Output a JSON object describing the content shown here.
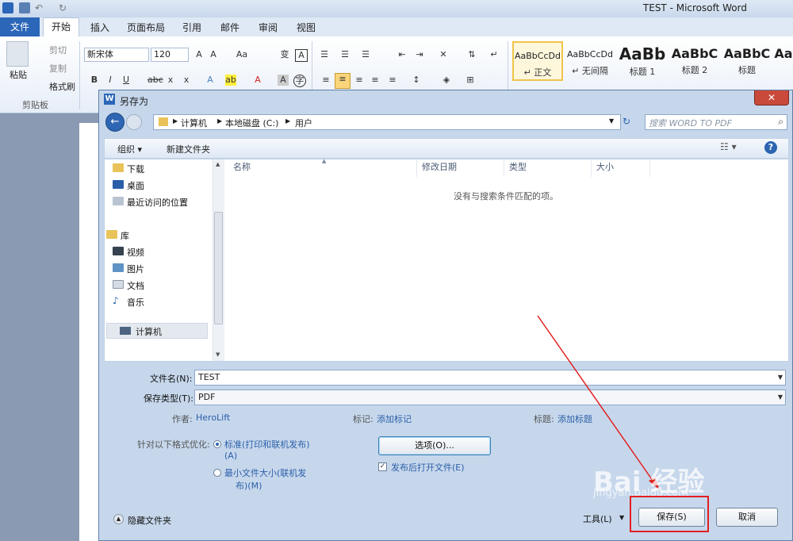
{
  "word": {
    "window_title": "TEST  -  Microsoft Word",
    "tabs": [
      "文件",
      "开始",
      "插入",
      "页面布局",
      "引用",
      "邮件",
      "审阅",
      "视图"
    ],
    "clipboard": {
      "paste": "粘贴",
      "cut": "剪切",
      "copy": "复制",
      "format_painter": "格式刷",
      "group": "剪贴板"
    },
    "font_name": "新宋体",
    "font_size": "120",
    "styles": [
      {
        "preview": "AaBbCcDd",
        "name": "↵ 正文"
      },
      {
        "preview": "AaBbCcDd",
        "name": "↵ 无间隔"
      },
      {
        "preview": "AaBb",
        "name": "标题 1"
      },
      {
        "preview": "AaBbC",
        "name": "标题 2"
      },
      {
        "preview": "AaBbC",
        "name": "标题"
      },
      {
        "preview": "Aa",
        "name": ""
      }
    ],
    "accent": "#2b66b8"
  },
  "dialog": {
    "title": "另存为",
    "close_label": "✕",
    "breadcrumb": [
      "计算机",
      "本地磁盘 (C:)",
      "用户"
    ],
    "search_placeholder": "搜索 WORD TO PDF",
    "organize": "组织 ▾",
    "new_folder": "新建文件夹",
    "nav_items": [
      {
        "label": "下载",
        "icon": "download-folder-icon"
      },
      {
        "label": "桌面",
        "icon": "desktop-icon"
      },
      {
        "label": "最近访问的位置",
        "icon": "recent-places-icon"
      },
      {
        "label": "库",
        "icon": "library-icon"
      },
      {
        "label": "视频",
        "icon": "video-icon"
      },
      {
        "label": "图片",
        "icon": "picture-icon"
      },
      {
        "label": "文档",
        "icon": "document-icon"
      },
      {
        "label": "音乐",
        "icon": "music-icon"
      },
      {
        "label": "计算机",
        "icon": "computer-icon"
      }
    ],
    "columns": [
      "名称",
      "修改日期",
      "类型",
      "大小"
    ],
    "empty_message": "没有与搜索条件匹配的项。",
    "filename_label": "文件名(N):",
    "filename_value": "TEST",
    "filetype_label": "保存类型(T):",
    "filetype_value": "PDF",
    "author_label": "作者:",
    "author_value": "HeroLift",
    "tags_label": "标记:",
    "tags_value": "添加标记",
    "title_label": "标题:",
    "title_value": "添加标题",
    "optimize_label": "针对以下格式优化:",
    "opt_standard": "标准(打印和联机发布)",
    "opt_standard_key": "(A)",
    "opt_min": "最小文件大小(联机发",
    "opt_min_2": "布)(M)",
    "options_button": "选项(O)...",
    "open_after": "发布后打开文件(E)",
    "hide_folders": "隐藏文件夹",
    "tools": "工具(L)",
    "save": "保存(S)",
    "cancel": "取消"
  },
  "watermark": {
    "main": "Bai 经验",
    "sub": "jingyan.baidu.com"
  }
}
